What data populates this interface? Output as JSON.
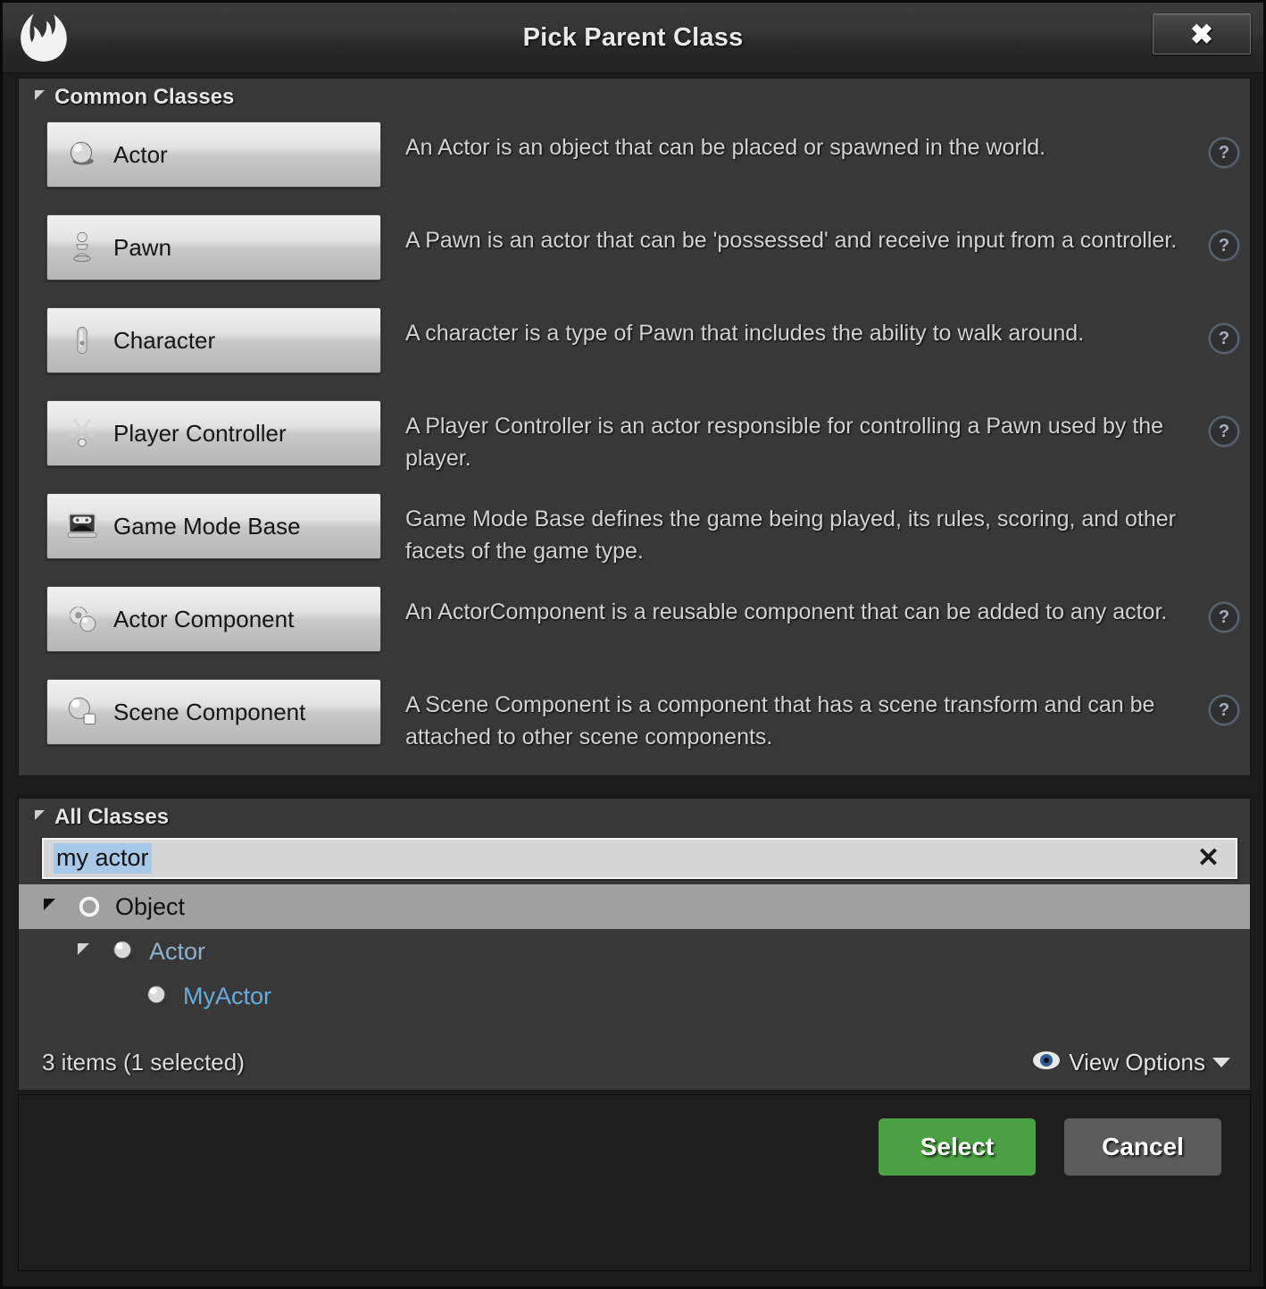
{
  "window": {
    "title": "Pick Parent Class",
    "logo_icon": "unreal-engine-logo",
    "close_icon": "close-icon",
    "close_glyph": "✖"
  },
  "common_classes": {
    "header_label": "Common Classes",
    "expander_icon": "triangle-expanded-icon",
    "help_glyph": "?",
    "items": [
      {
        "label": "Actor",
        "icon": "actor-sphere-icon",
        "description": "An Actor is an object that can be placed or spawned in the world.",
        "has_help": true
      },
      {
        "label": "Pawn",
        "icon": "pawn-chess-piece-icon",
        "description": "A Pawn is an actor that can be 'possessed' and receive input from a controller.",
        "has_help": true
      },
      {
        "label": "Character",
        "icon": "character-capsule-icon",
        "description": "A character is a type of Pawn that includes the ability to walk around.",
        "has_help": true
      },
      {
        "label": "Player Controller",
        "icon": "player-controller-icon",
        "description": "A Player Controller is an actor responsible for controlling a Pawn used by the player.",
        "has_help": true
      },
      {
        "label": "Game Mode Base",
        "icon": "game-mode-base-icon",
        "description": "Game Mode Base defines the game being played, its rules, scoring, and other facets of the game type.",
        "has_help": false
      },
      {
        "label": "Actor Component",
        "icon": "actor-component-icon",
        "description": "An ActorComponent is a reusable component that can be added to any actor.",
        "has_help": true
      },
      {
        "label": "Scene Component",
        "icon": "scene-component-icon",
        "description": "A Scene Component is a component that has a scene transform and can be attached to other scene components.",
        "has_help": true
      }
    ]
  },
  "all_classes": {
    "header_label": "All Classes",
    "expander_icon": "triangle-expanded-icon",
    "search": {
      "value": "my actor",
      "placeholder": "Search Classes",
      "clear_icon": "close-icon",
      "clear_glyph": "✕",
      "selection_color": "#a8c8e8"
    },
    "tree": [
      {
        "label": "Object",
        "icon": "object-ring-icon",
        "indent": 0,
        "selected": true,
        "has_arrow": true
      },
      {
        "label": "Actor",
        "icon": "actor-sphere-icon",
        "indent": 1,
        "selected": false,
        "has_arrow": true
      },
      {
        "label": "MyActor",
        "icon": "actor-sphere-icon",
        "indent": 2,
        "selected": false,
        "has_arrow": false
      }
    ],
    "status": {
      "items_text": "3 items (1 selected)",
      "view_options_label": "View Options",
      "eye_icon": "eye-icon",
      "caret_icon": "chevron-down-icon"
    }
  },
  "footer": {
    "select_label": "Select",
    "cancel_label": "Cancel",
    "select_color": "#4aa043",
    "cancel_color": "#5c5c5c"
  }
}
